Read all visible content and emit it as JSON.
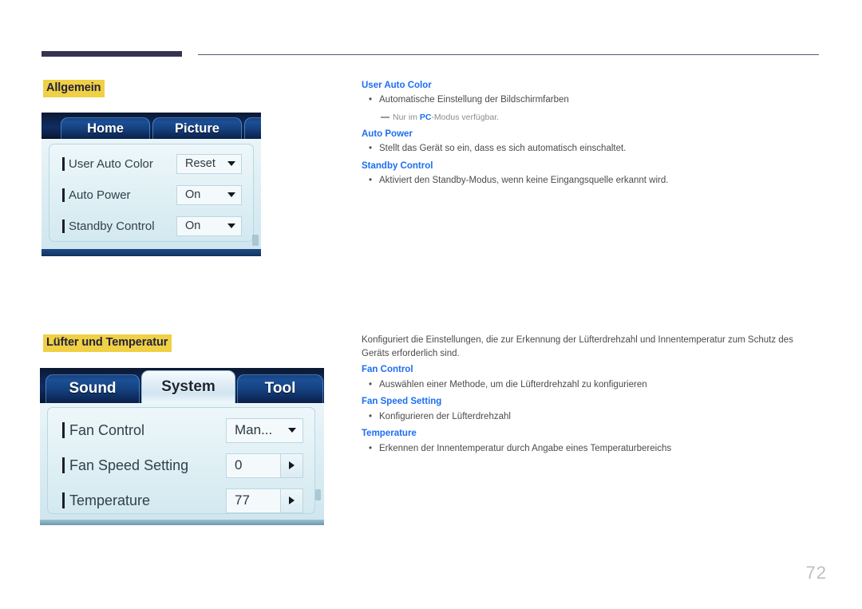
{
  "page": {
    "number": "72"
  },
  "sections": [
    {
      "heading": "Allgemein",
      "osd": {
        "tabs": [
          {
            "label": "Home",
            "active": false
          },
          {
            "label": "Picture",
            "active": false
          },
          {
            "label": "",
            "active": false
          }
        ],
        "rows": [
          {
            "label": "User Auto Color",
            "value": "Reset",
            "control": "dropdown"
          },
          {
            "label": "Auto Power",
            "value": "On",
            "control": "dropdown"
          },
          {
            "label": "Standby Control",
            "value": "On",
            "control": "dropdown"
          }
        ]
      },
      "text": {
        "intro": "",
        "items": [
          {
            "title": "User Auto Color",
            "bullet": "Automatische Einstellung der Bildschirmfarben",
            "note_before": "Nur im ",
            "note_highlight": "PC",
            "note_after": "-Modus verfügbar."
          },
          {
            "title": "Auto Power",
            "bullet": "Stellt das Gerät so ein, dass es sich automatisch einschaltet."
          },
          {
            "title": "Standby Control",
            "bullet": "Aktiviert den Standby-Modus, wenn keine Eingangsquelle erkannt wird."
          }
        ]
      }
    },
    {
      "heading": "Lüfter und Temperatur",
      "osd": {
        "tabs": [
          {
            "label": "Sound",
            "active": false
          },
          {
            "label": "System",
            "active": true
          },
          {
            "label": "Tool",
            "active": false
          }
        ],
        "rows": [
          {
            "label": "Fan Control",
            "value": "Man...",
            "control": "dropdown"
          },
          {
            "label": "Fan Speed Setting",
            "value": "0",
            "control": "stepper"
          },
          {
            "label": "Temperature",
            "value": "77",
            "control": "stepper"
          }
        ]
      },
      "text": {
        "intro": "Konfiguriert die Einstellungen, die zur Erkennung der Lüfterdrehzahl und Innentemperatur zum Schutz des Geräts erforderlich sind.",
        "items": [
          {
            "title": "Fan Control",
            "bullet": "Auswählen einer Methode, um die Lüfterdrehzahl zu konfigurieren"
          },
          {
            "title": "Fan Speed Setting",
            "bullet": "Konfigurieren der Lüfterdrehzahl"
          },
          {
            "title": "Temperature",
            "bullet": "Erkennen der Innentemperatur durch Angabe eines Temperaturbereichs"
          }
        ]
      }
    }
  ],
  "colors": {
    "heading_highlight": "#f0d044",
    "heading_text": "#22223c",
    "link_blue": "#1c6ff0",
    "rule_navy": "#343452",
    "body_text": "#4b4b4b",
    "page_number": "#bfbfbf"
  }
}
